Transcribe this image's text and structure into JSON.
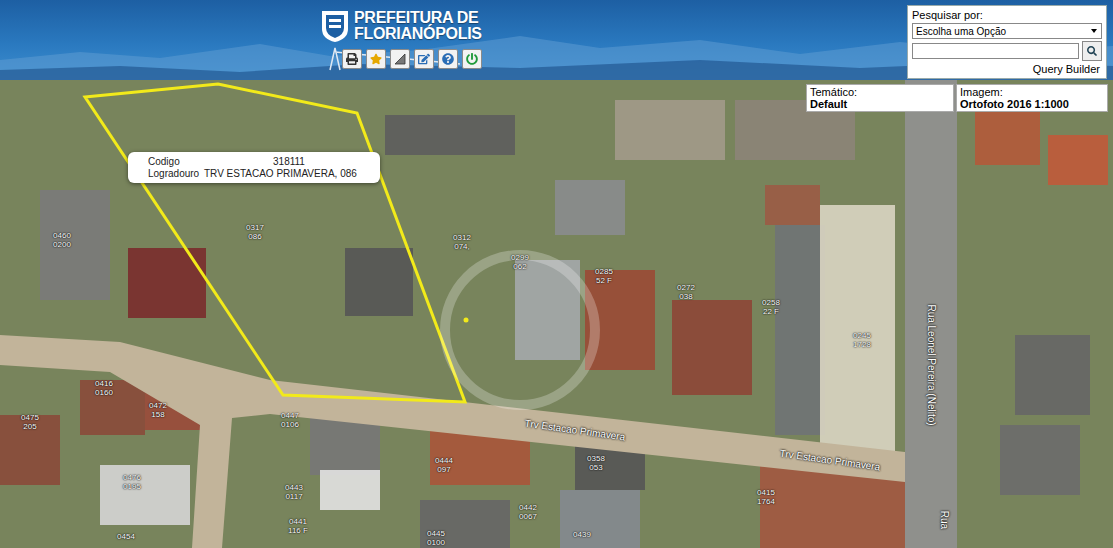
{
  "header": {
    "title_line1": "PREFEITURA DE",
    "title_line2": "FLORIANÓPOLIS"
  },
  "search": {
    "label": "Pesquisar por:",
    "select_value": "Escolha uma Opção",
    "input_value": "",
    "link": "Query Builder"
  },
  "info_boxes": [
    {
      "label": "Temático:",
      "value": "Default"
    },
    {
      "label": "Imagem:",
      "value": "Ortofoto 2016 1:1000"
    }
  ],
  "tooltip": {
    "rows": [
      {
        "key": "Codigo",
        "value": "318111"
      },
      {
        "key": "Logradouro",
        "value": "TRV ESTACAO PRIMAVERA, 086"
      }
    ]
  },
  "parcels": [
    {
      "code": "0460",
      "number": "0200"
    },
    {
      "code": "0317",
      "number": "086"
    },
    {
      "code": "0312",
      "number": "074,"
    },
    {
      "code": "0299",
      "number": "062"
    },
    {
      "code": "0285",
      "number": "52 F"
    },
    {
      "code": "0272",
      "number": "038"
    },
    {
      "code": "0258",
      "number": "22 F"
    },
    {
      "code": "0245",
      "number": "1728"
    },
    {
      "code": "0416",
      "number": "0160"
    },
    {
      "code": "0472",
      "number": "158"
    },
    {
      "code": "0475",
      "number": "205"
    },
    {
      "code": "0447",
      "number": "0106"
    },
    {
      "code": "0444",
      "number": "097"
    },
    {
      "code": "0358",
      "number": "053"
    },
    {
      "code": "0415",
      "number": "1764"
    },
    {
      "code": "0476",
      "number": "0195"
    },
    {
      "code": "0443",
      "number": "0117"
    },
    {
      "code": "0442",
      "number": "0067"
    },
    {
      "code": "0441",
      "number": "116 F"
    },
    {
      "code": "0445",
      "number": "0100"
    },
    {
      "code": "0439"
    },
    {
      "code": "0454"
    }
  ],
  "streets": [
    {
      "name": "Trv Estacao Primavera"
    },
    {
      "name": "Trv Estacao Primavera"
    },
    {
      "name": "Rua Leonel Pereira (Nelito)"
    },
    {
      "name": "Rua"
    }
  ]
}
